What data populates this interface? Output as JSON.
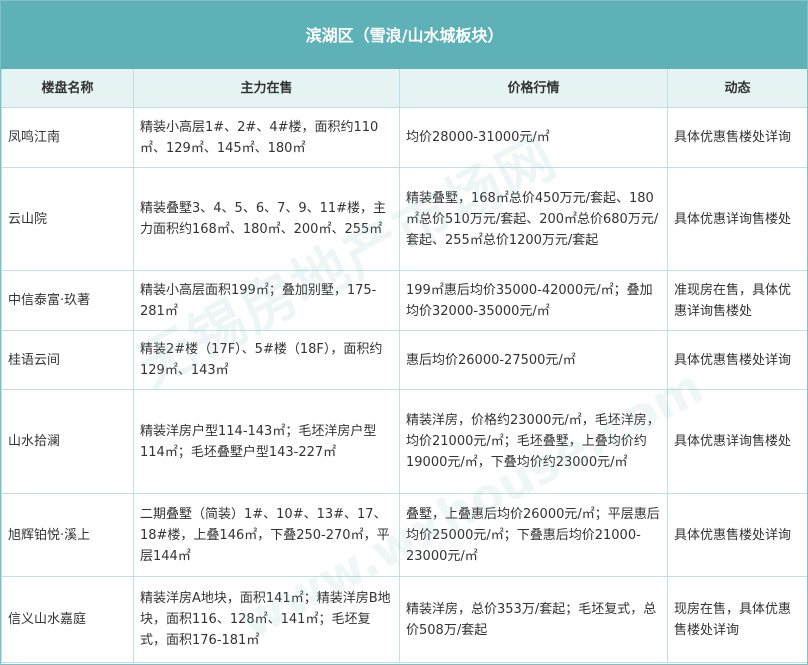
{
  "title": "滨湖区（雪浪/山水城板块）",
  "headers": {
    "name": "楼盘名称",
    "main_sale": "主力在售",
    "price": "价格行情",
    "status": "动态"
  },
  "rows": [
    {
      "name": "凤鸣江南",
      "main_sale": "精装小高层1#、2#、4#楼，面积约110㎡、129㎡、145㎡、180㎡",
      "price": "均价28000-31000元/㎡",
      "status": "具体优惠售楼处详询"
    },
    {
      "name": "云山院",
      "main_sale": "精装叠墅3、4、5、6、7、9、11#楼，主力面积约168㎡、180㎡、200㎡、255㎡",
      "price": "精装叠墅，168㎡总价450万元/套起、180㎡总价510万元/套起、200㎡总价680万元/套起、255㎡总价1200万元/套起",
      "status": "具体优惠详询售楼处"
    },
    {
      "name": "中信泰富·玖著",
      "main_sale": "精装小高层面积199㎡；叠加别墅，175-281㎡",
      "price": "199㎡惠后均价35000-42000元/㎡；叠加均价32000-35000元/㎡",
      "status": "准现房在售，具体优惠详询售楼处"
    },
    {
      "name": "桂语云间",
      "main_sale": "精装2#楼（17F）、5#楼（18F），面积约129㎡、143㎡",
      "price": "惠后均价26000-27500元/㎡",
      "status": "具体优惠售楼处详询"
    },
    {
      "name": "山水拾澜",
      "main_sale": "精装洋房户型114-143㎡；毛坯洋房户型114㎡；毛坯叠墅户型143-227㎡",
      "price": "精装洋房，价格约23000元/㎡，毛坯洋房，均价21000元/㎡；毛坯叠墅，上叠均价约19000元/㎡，下叠均价约23000元/㎡",
      "status": "具体优惠详询售楼处"
    },
    {
      "name": "旭辉铂悦·溪上",
      "main_sale": "二期叠墅（简装）1#、10#、13#、17、18#楼，上叠146㎡，下叠250-270㎡，平层144㎡",
      "price": "叠墅，上叠惠后均价26000元/㎡；平层惠后均价25000元/㎡；下叠惠后均价21000-23000元/㎡",
      "status": "具体优惠售楼处详询"
    },
    {
      "name": "信义山水嘉庭",
      "main_sale": "精装洋房A地块，面积141㎡；精装洋房B地块，面积116、128㎡、141㎡；毛坯复式，面积176-181㎡",
      "price": "精装洋房，总价353万/套起；毛坯复式，总价508万/套起",
      "status": "现房在售，具体优惠售楼处详询"
    }
  ],
  "watermark": "无锡房地产市场网",
  "watermark_url": "www.wxhouse.com"
}
